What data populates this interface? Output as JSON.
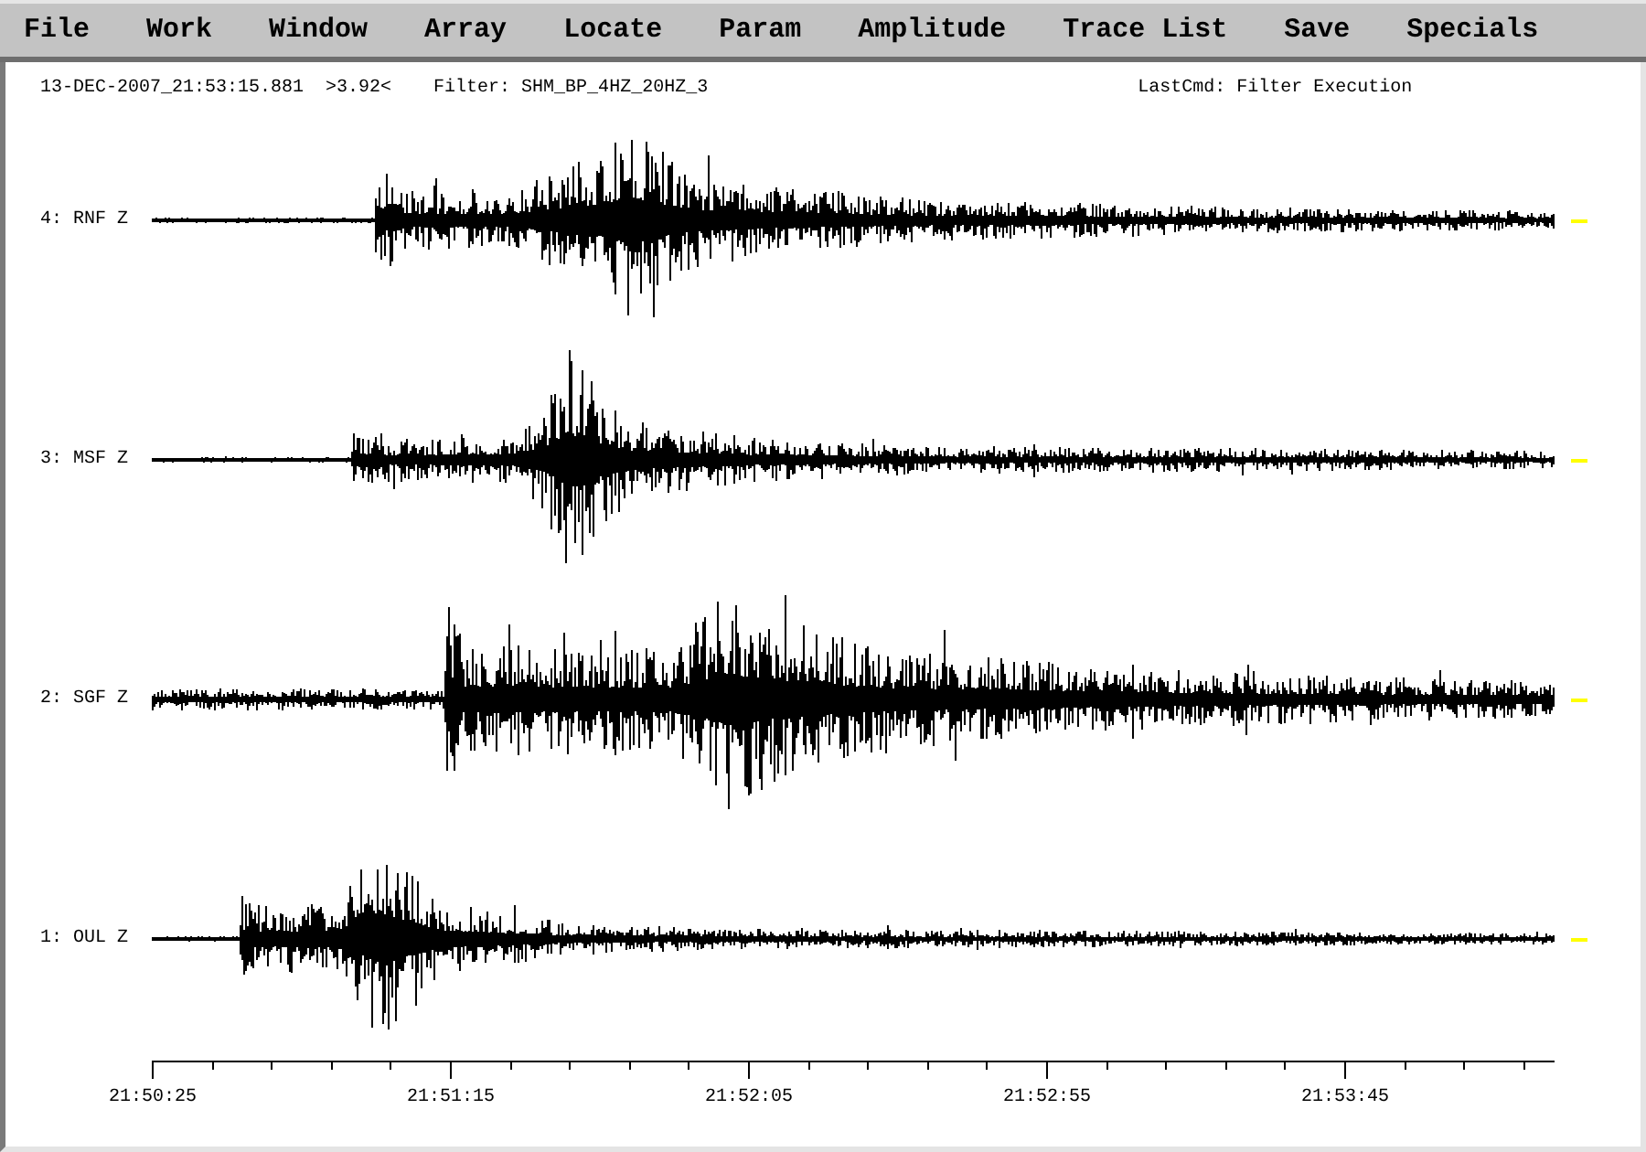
{
  "menu_bar": {
    "items": [
      "File",
      "Work",
      "Window",
      "Array",
      "Locate",
      "Param",
      "Amplitude",
      "Trace List",
      "Save",
      "Specials"
    ]
  },
  "status_line": {
    "timestamp": "13-DEC-2007_21:53:15.881",
    "amplitude": ">3.92<",
    "filter": "Filter: SHM_BP_4HZ_20HZ_3",
    "last_command": "LastCmd: Filter Execution"
  },
  "traces": [
    {
      "label": "4: RNF Z"
    },
    {
      "label": "3: MSF Z"
    },
    {
      "label": "2: SGF Z"
    },
    {
      "label": "1: OUL Z"
    }
  ],
  "time_axis": {
    "labels": [
      "21:50:25",
      "21:51:15",
      "21:52:05",
      "21:52:55",
      "21:53:45"
    ]
  }
}
